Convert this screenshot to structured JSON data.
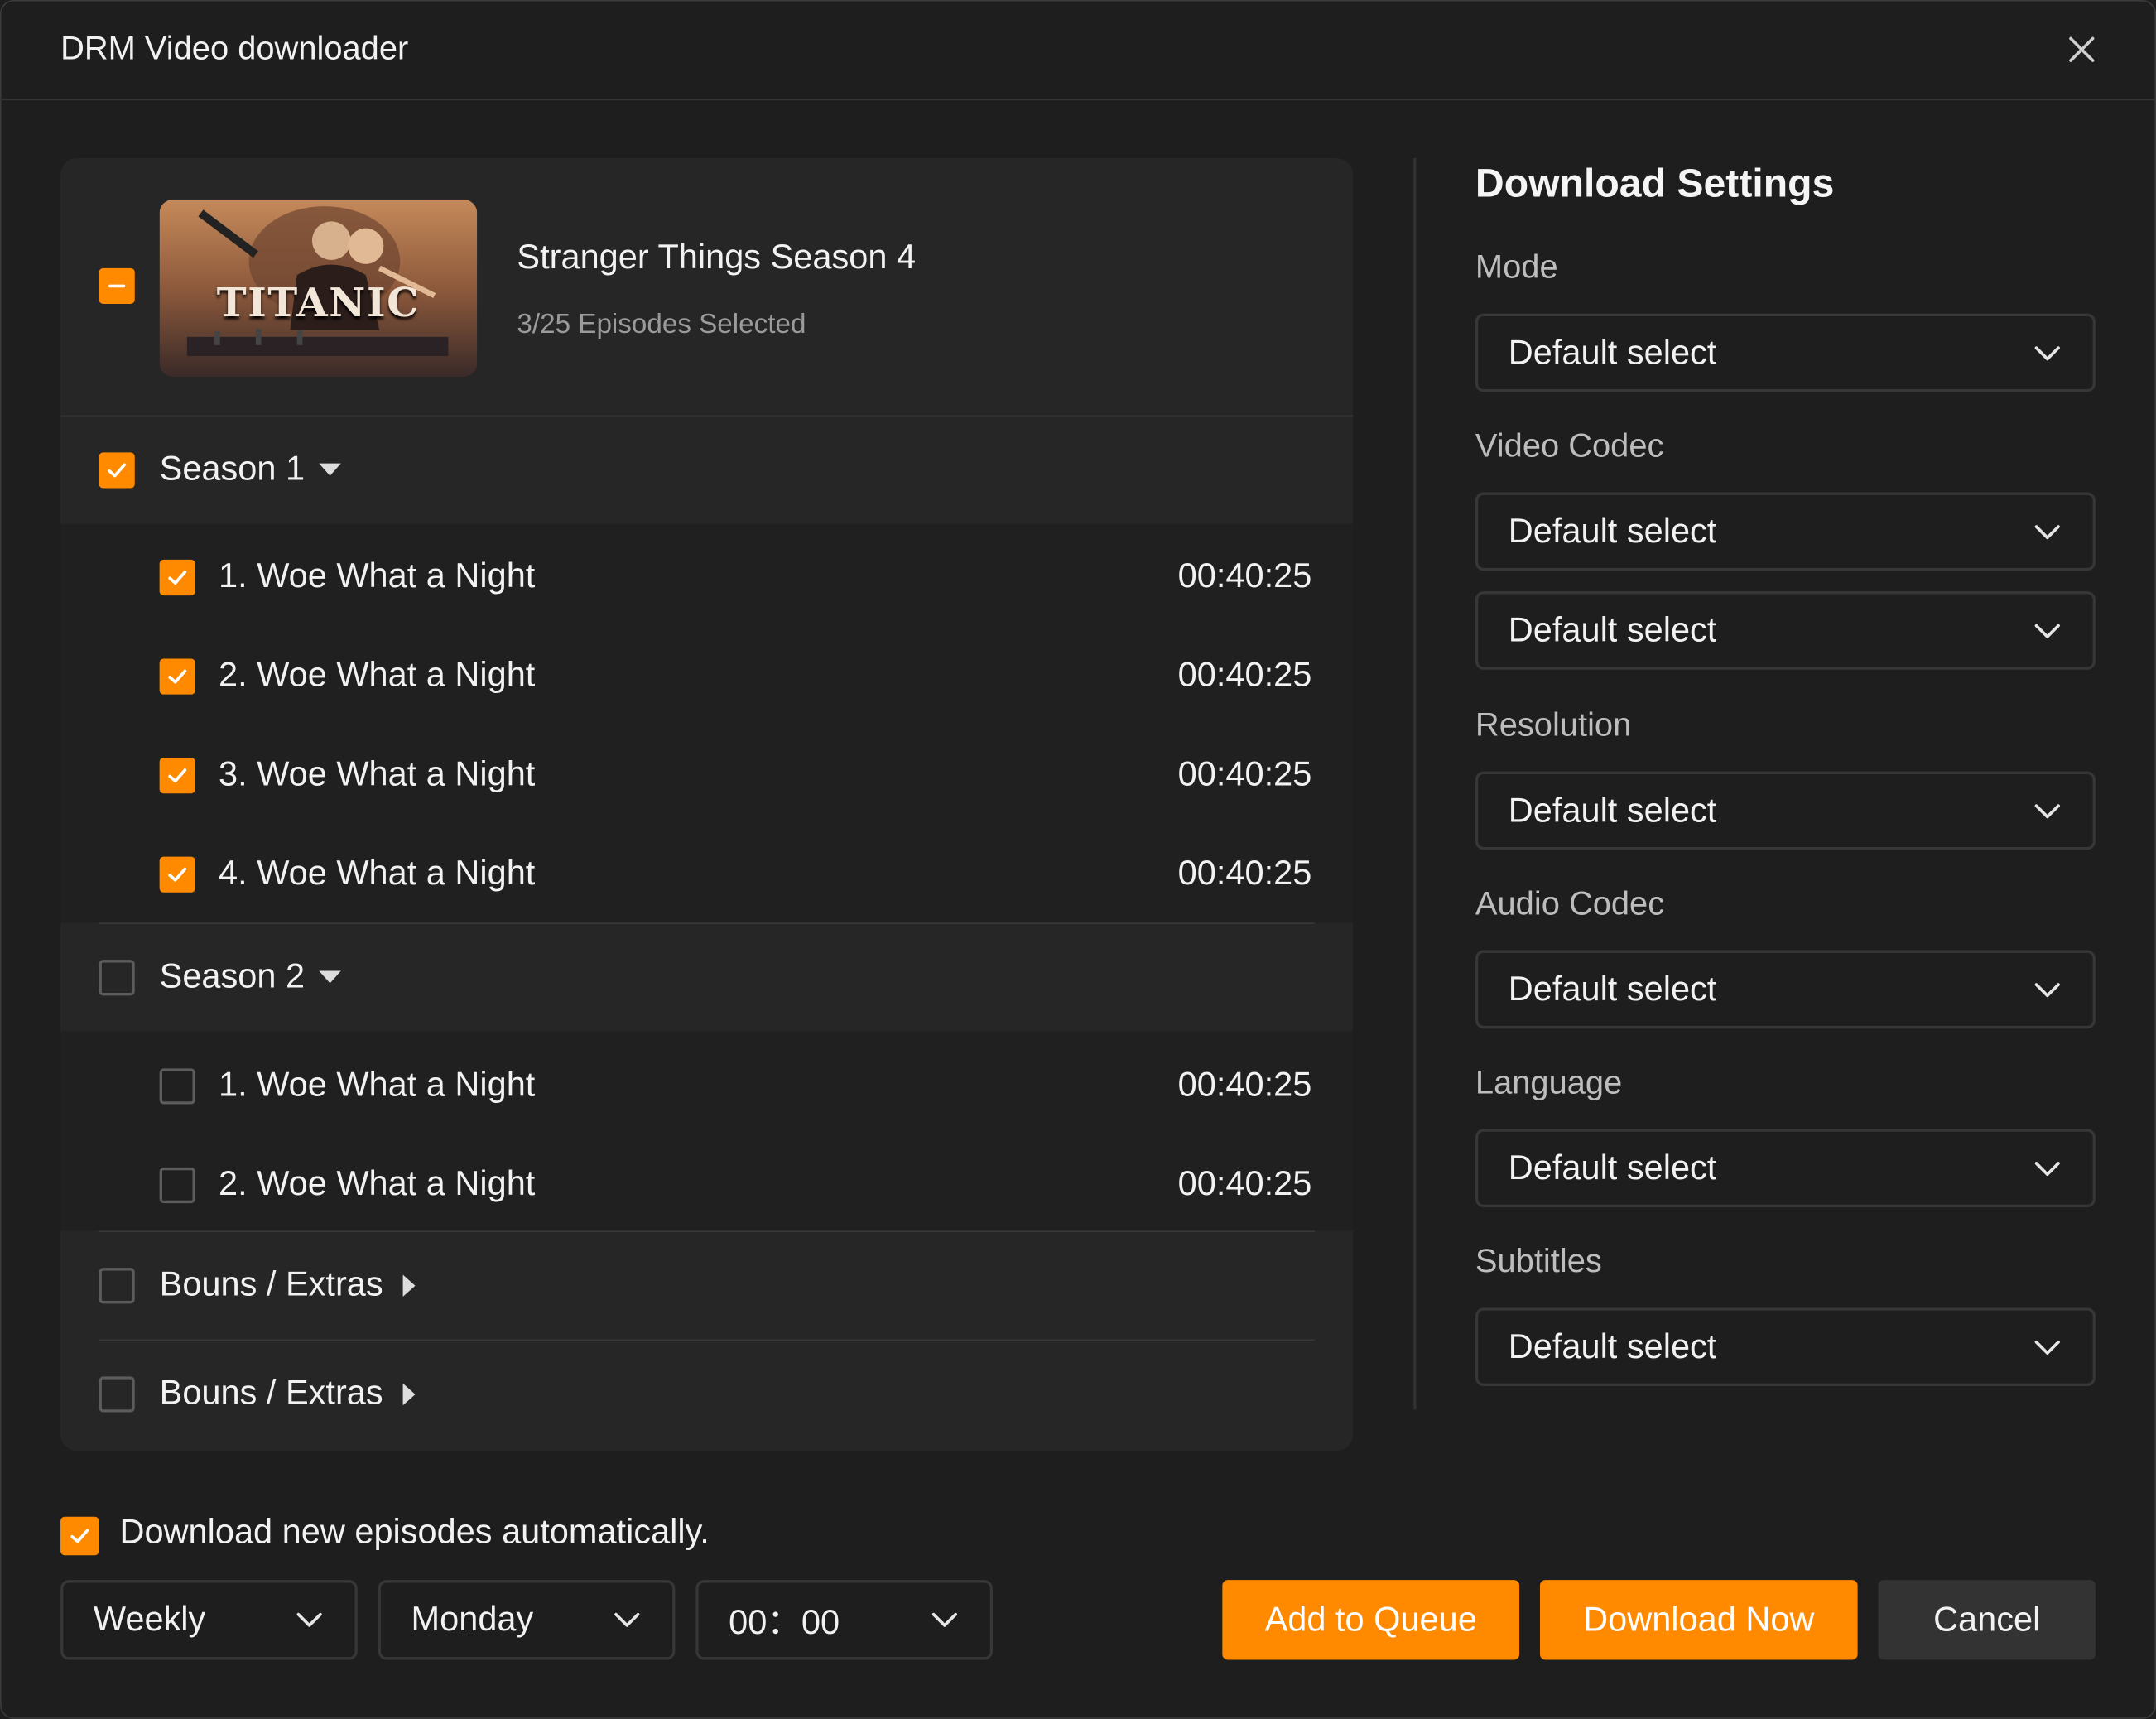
{
  "window": {
    "title": "DRM Video downloader"
  },
  "show": {
    "title": "Stranger Things Season 4",
    "subtitle": "3/25 Episodes Selected",
    "thumbnail_text": "TITANIC"
  },
  "seasons": [
    {
      "label": "Season 1",
      "checked": true,
      "episodes": [
        {
          "title": "1. Woe What a Night",
          "duration": "00:40:25",
          "checked": true
        },
        {
          "title": "2. Woe What a Night",
          "duration": "00:40:25",
          "checked": true
        },
        {
          "title": "3. Woe What a Night",
          "duration": "00:40:25",
          "checked": true
        },
        {
          "title": "4. Woe What a Night",
          "duration": "00:40:25",
          "checked": true
        }
      ]
    },
    {
      "label": "Season 2",
      "checked": false,
      "episodes": [
        {
          "title": "1. Woe What a Night",
          "duration": "00:40:25",
          "checked": false
        },
        {
          "title": "2. Woe What a Night",
          "duration": "00:40:25",
          "checked": false
        }
      ]
    }
  ],
  "extras": [
    {
      "label": "Bouns / Extras",
      "checked": false
    },
    {
      "label": "Bouns / Extras",
      "checked": false
    }
  ],
  "settings": {
    "title": "Download Settings",
    "mode_label": "Mode",
    "mode_value": "Default select",
    "video_codec_label": "Video Codec",
    "video_codec_value": "Default select",
    "video_codec_value_2": "Default select",
    "resolution_label": "Resolution",
    "resolution_value": "Default select",
    "audio_codec_label": "Audio Codec",
    "audio_codec_value": "Default select",
    "language_label": "Language",
    "language_value": "Default select",
    "subtitles_label": "Subtitles",
    "subtitles_value": "Default select"
  },
  "schedule": {
    "auto_label": "Download new episodes automatically.",
    "auto_checked": true,
    "frequency": "Weekly",
    "day": "Monday",
    "time": "00：00"
  },
  "buttons": {
    "add_to_queue": "Add to Queue",
    "download_now": "Download Now",
    "cancel": "Cancel"
  },
  "colors": {
    "accent": "#ff8a00",
    "background": "#1e1e1e",
    "panel": "#262626"
  }
}
